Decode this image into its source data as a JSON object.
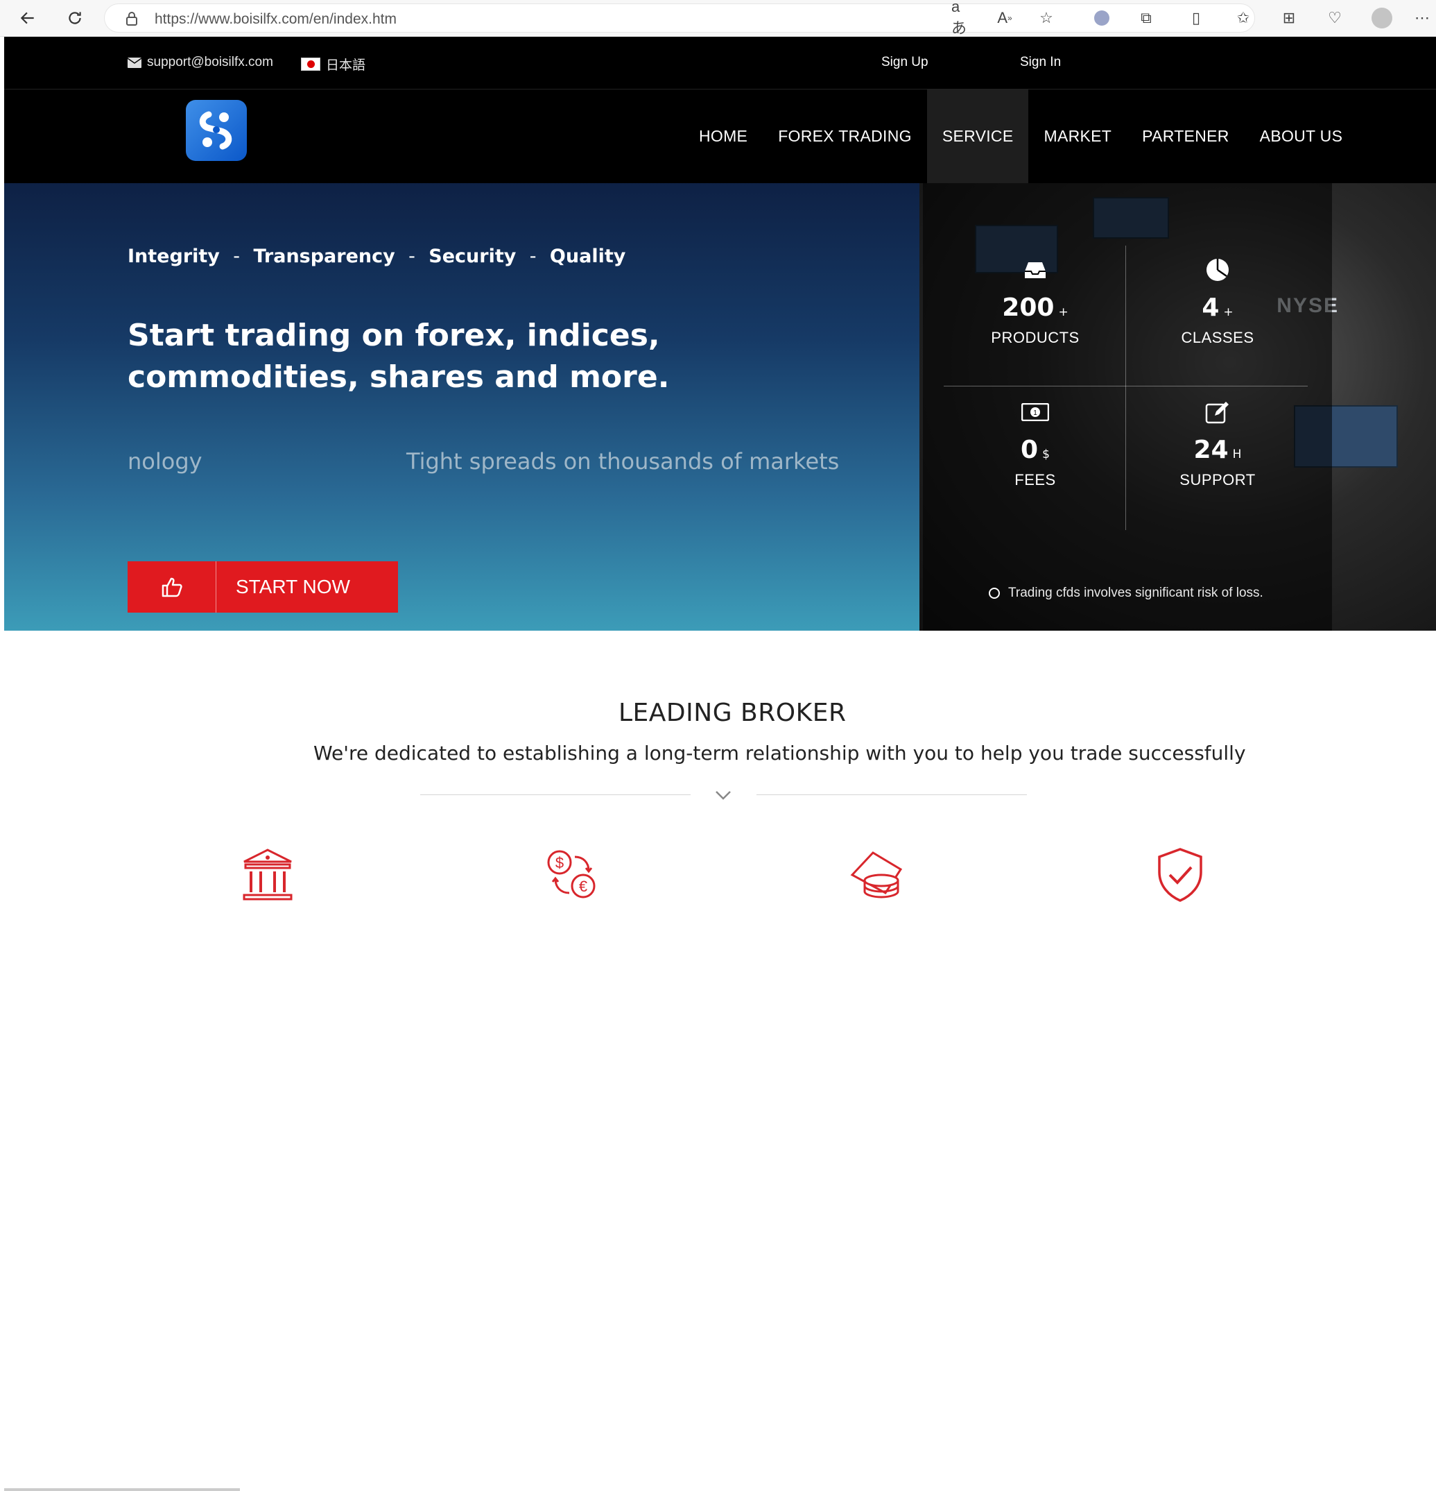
{
  "browser": {
    "url": "https://www.boisilfx.com/en/index.htm"
  },
  "topbar": {
    "email": "support@boisilfx.com",
    "language": "日本語",
    "signup": "Sign Up",
    "signin": "Sign In"
  },
  "nav": {
    "items": [
      {
        "label": "HOME",
        "active": false
      },
      {
        "label": "FOREX TRADING",
        "active": false
      },
      {
        "label": "SERVICE",
        "active": true
      },
      {
        "label": "MARKET",
        "active": false
      },
      {
        "label": "PARTENER",
        "active": false
      },
      {
        "label": "ABOUT US",
        "active": false
      }
    ]
  },
  "hero": {
    "pillars": [
      "Integrity",
      "Transparency",
      "Security",
      "Quality"
    ],
    "separator": "-",
    "headline": "Start trading on forex, indices, commodities, shares and more.",
    "sub_a": "nology",
    "sub_b": "Tight spreads on thousands of markets",
    "cta": "START NOW"
  },
  "stats": [
    {
      "icon": "inbox-icon",
      "value": "200",
      "suffix": "+",
      "label": "PRODUCTS"
    },
    {
      "icon": "pie-chart-icon",
      "value": "4",
      "suffix": "+",
      "label": "CLASSES"
    },
    {
      "icon": "money-icon",
      "value": "0",
      "suffix": "$",
      "label": "FEES"
    },
    {
      "icon": "edit-icon",
      "value": "24",
      "suffix": "H",
      "label": "SUPPORT"
    }
  ],
  "risk_notice": "Trading cfds involves significant risk of loss.",
  "leading": {
    "title": "LEADING BROKER",
    "tagline": "We're dedicated to establishing a long-term relationship with you to help you trade successfully",
    "features": [
      {
        "icon": "bank-icon"
      },
      {
        "icon": "currency-exchange-icon"
      },
      {
        "icon": "coins-icon"
      },
      {
        "icon": "shield-check-icon"
      }
    ]
  },
  "colors": {
    "accent": "#e01a1f",
    "nav_bg": "#000000",
    "active_nav_bg": "#1e1e1e",
    "logo": "#1b6fd8"
  }
}
